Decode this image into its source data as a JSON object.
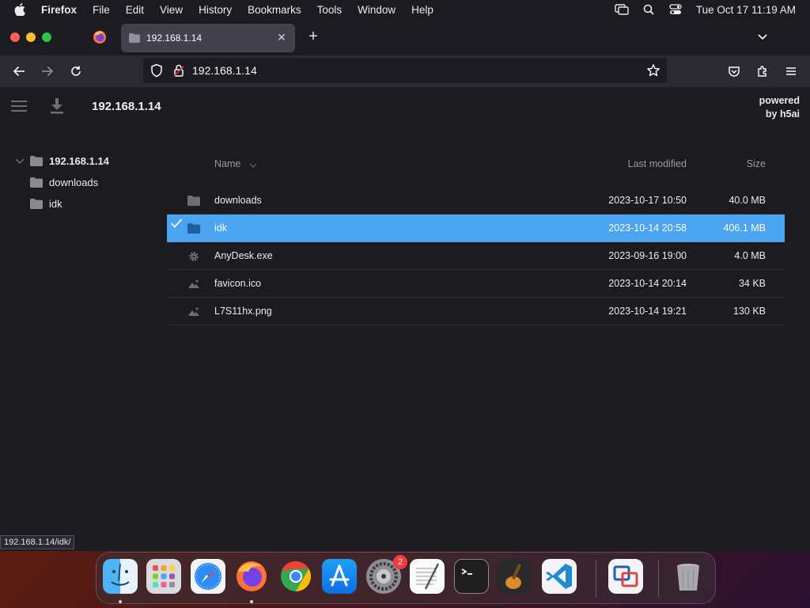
{
  "menubar": {
    "app_name": "Firefox",
    "items": [
      "File",
      "Edit",
      "View",
      "History",
      "Bookmarks",
      "Tools",
      "Window",
      "Help"
    ],
    "clock": "Tue Oct 17  11:19 AM"
  },
  "browser": {
    "tab_title": "192.168.1.14",
    "tab_close": "✕",
    "new_tab": "+",
    "url": "192.168.1.14"
  },
  "page": {
    "breadcrumb": "192.168.1.14",
    "powered_line1": "powered",
    "powered_line2": "by h5ai",
    "tree": {
      "root": "192.168.1.14",
      "children": [
        "downloads",
        "idk"
      ]
    },
    "headers": {
      "name": "Name",
      "modified": "Last modified",
      "size": "Size"
    },
    "files": [
      {
        "name": "downloads",
        "modified": "2023-10-17 10:50",
        "size": "40.0 MB",
        "icon": "folder-icon",
        "selected": false
      },
      {
        "name": "idk",
        "modified": "2023-10-14 20:58",
        "size": "406.1 MB",
        "icon": "folder-icon",
        "selected": true
      },
      {
        "name": "AnyDesk.exe",
        "modified": "2023-09-16 19:00",
        "size": "4.0 MB",
        "icon": "gear-icon",
        "selected": false
      },
      {
        "name": "favicon.ico",
        "modified": "2023-10-14 20:14",
        "size": "34 KB",
        "icon": "image-icon",
        "selected": false
      },
      {
        "name": "L7S11hx.png",
        "modified": "2023-10-14 19:21",
        "size": "130 KB",
        "icon": "image-icon",
        "selected": false
      }
    ]
  },
  "status_link": "192.168.1.14/idk/",
  "dock": {
    "items": [
      "Finder",
      "Launchpad",
      "Safari",
      "Firefox",
      "Chrome",
      "App Store",
      "System Settings",
      "TextEdit",
      "Terminal",
      "GarageBand",
      "Visual Studio Code",
      "Remote Desktop",
      "Trash"
    ],
    "settings_badge": "2"
  },
  "colors": {
    "selection": "#4aa4f0",
    "page_bg": "#1c1b1f",
    "toolbar_bg": "#2b2a33"
  }
}
